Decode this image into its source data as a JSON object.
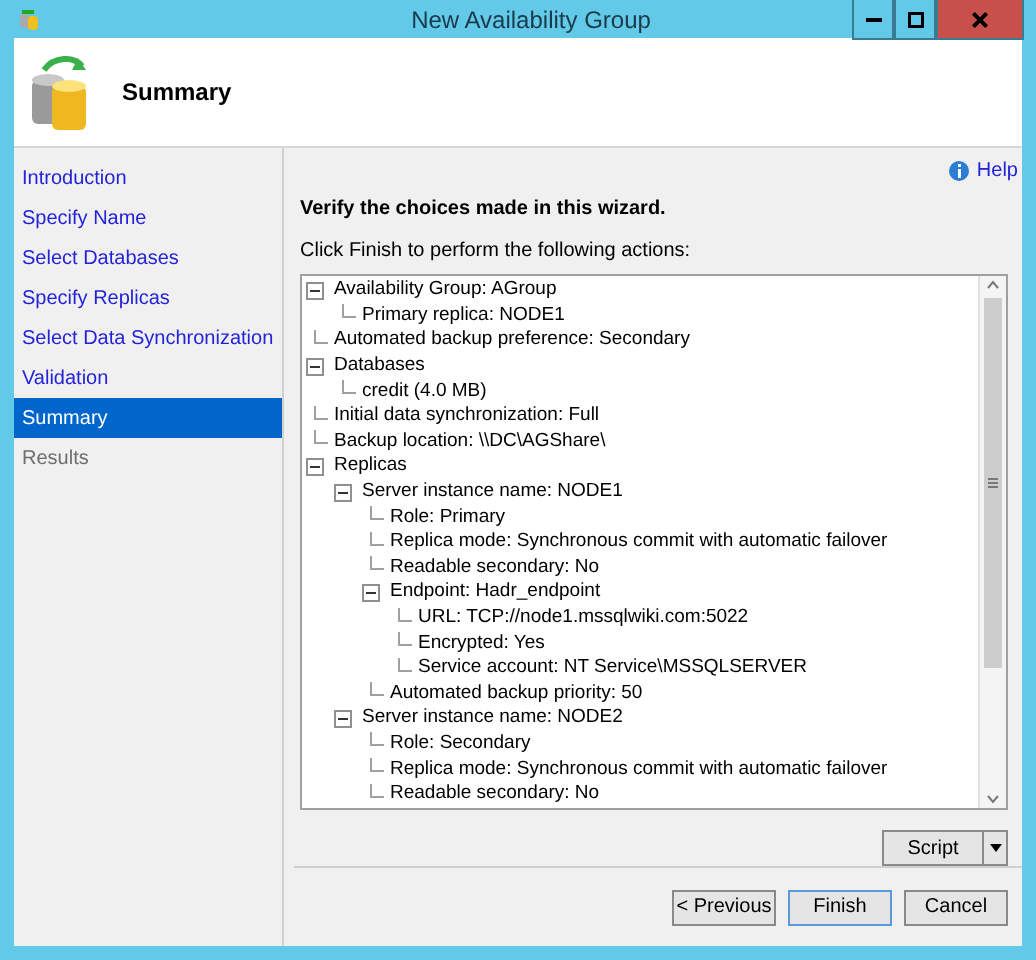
{
  "window": {
    "title": "New Availability Group"
  },
  "header": {
    "title": "Summary"
  },
  "sidebar": {
    "items": [
      {
        "label": "Introduction",
        "selected": false,
        "disabled": false
      },
      {
        "label": "Specify Name",
        "selected": false,
        "disabled": false
      },
      {
        "label": "Select Databases",
        "selected": false,
        "disabled": false
      },
      {
        "label": "Specify Replicas",
        "selected": false,
        "disabled": false
      },
      {
        "label": "Select Data Synchronization",
        "selected": false,
        "disabled": false
      },
      {
        "label": "Validation",
        "selected": false,
        "disabled": false
      },
      {
        "label": "Summary",
        "selected": true,
        "disabled": false
      },
      {
        "label": "Results",
        "selected": false,
        "disabled": true
      }
    ]
  },
  "help_link": "Help",
  "heading": "Verify the choices made in this wizard.",
  "instruction": "Click Finish to perform the following actions:",
  "tree": [
    {
      "text": "Availability Group: AGroup",
      "expanded": true,
      "children": [
        {
          "text": "Primary replica: NODE1"
        }
      ]
    },
    {
      "text": "Automated backup preference: Secondary"
    },
    {
      "text": "Databases",
      "expanded": true,
      "children": [
        {
          "text": "credit (4.0 MB)"
        }
      ]
    },
    {
      "text": "Initial data synchronization: Full"
    },
    {
      "text": "Backup location: \\\\DC\\AGShare\\"
    },
    {
      "text": "Replicas",
      "expanded": true,
      "children": [
        {
          "text": "Server instance name: NODE1",
          "expanded": true,
          "children": [
            {
              "text": "Role: Primary"
            },
            {
              "text": "Replica mode: Synchronous commit with automatic failover"
            },
            {
              "text": "Readable secondary: No"
            },
            {
              "text": "Endpoint: Hadr_endpoint",
              "expanded": true,
              "children": [
                {
                  "text": "URL: TCP://node1.mssqlwiki.com:5022"
                },
                {
                  "text": "Encrypted: Yes"
                },
                {
                  "text": "Service account: NT Service\\MSSQLSERVER"
                }
              ]
            },
            {
              "text": "Automated backup priority: 50"
            }
          ]
        },
        {
          "text": "Server instance name: NODE2",
          "expanded": true,
          "children": [
            {
              "text": "Role: Secondary"
            },
            {
              "text": "Replica mode: Synchronous commit with automatic failover"
            },
            {
              "text": "Readable secondary: No"
            }
          ]
        }
      ]
    }
  ],
  "script_button": "Script",
  "buttons": [
    "< Previous",
    "Finish",
    "Cancel"
  ]
}
